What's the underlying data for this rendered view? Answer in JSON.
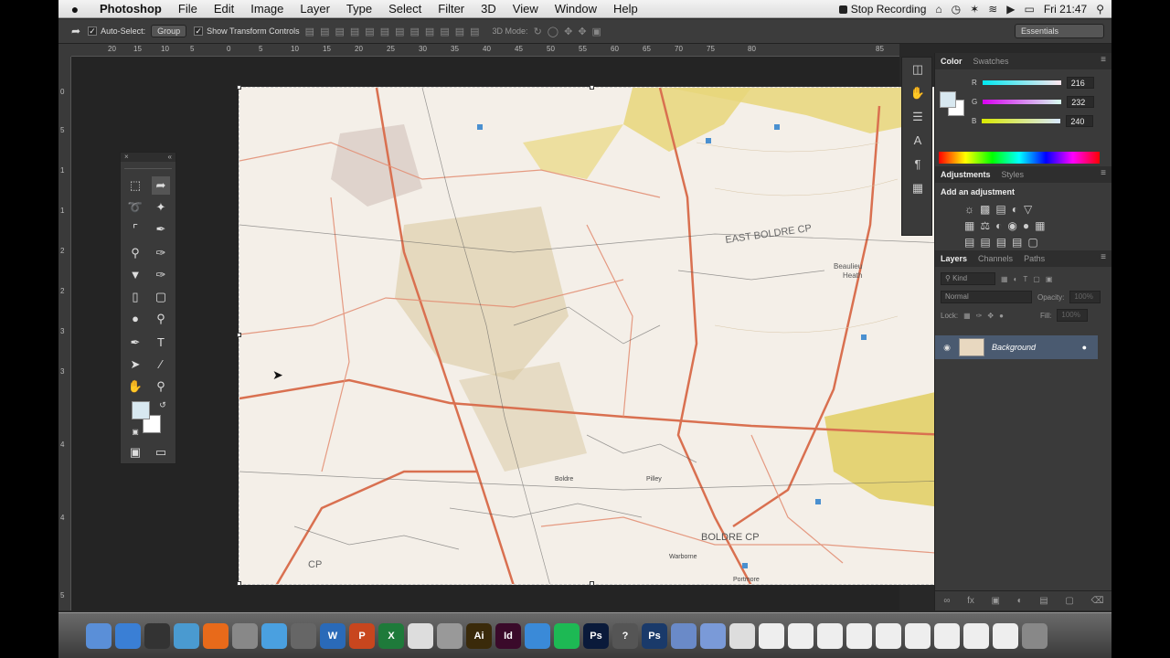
{
  "menubar": {
    "app": "Photoshop",
    "items": [
      "File",
      "Edit",
      "Image",
      "Layer",
      "Type",
      "Select",
      "Filter",
      "3D",
      "View",
      "Window",
      "Help"
    ],
    "stop_recording": "Stop Recording",
    "clock": "Fri 21:47"
  },
  "options": {
    "auto_select": "Auto-Select:",
    "group": "Group",
    "show_transform": "Show Transform Controls",
    "mode_3d": "3D Mode:",
    "workspace": "Essentials"
  },
  "ruler_h": [
    "20",
    "15",
    "10",
    "5",
    "0",
    "5",
    "10",
    "15",
    "20",
    "25",
    "30",
    "35",
    "40",
    "45",
    "50",
    "55",
    "60",
    "65",
    "70",
    "75",
    "80",
    "85"
  ],
  "ruler_v": [
    "0",
    "5",
    "1",
    "1",
    "2",
    "2",
    "3",
    "3",
    "4",
    "4",
    "5"
  ],
  "color_panel": {
    "tabs": [
      "Color",
      "Swatches"
    ],
    "r_label": "R",
    "r": "216",
    "g_label": "G",
    "g": "232",
    "b_label": "B",
    "b": "240",
    "fg_color": "#d8e8f0"
  },
  "adjustments": {
    "tabs": [
      "Adjustments",
      "Styles"
    ],
    "title": "Add an adjustment"
  },
  "layers_panel": {
    "tabs": [
      "Layers",
      "Channels",
      "Paths"
    ],
    "kind": "Kind",
    "blend": "Normal",
    "opacity_label": "Opacity:",
    "opacity": "100%",
    "lock_label": "Lock:",
    "fill_label": "Fill:",
    "fill": "100%",
    "layer_name": "Background"
  },
  "map_labels": {
    "east_boldre": "EAST BOLDRE CP",
    "beaulieu": "Beaulieu",
    "heath": "Heath",
    "boldre_cp": "BOLDRE CP",
    "warborne": "Warborne",
    "pilley": "Pilley",
    "portmore": "Portmore",
    "boldre": "Boldre",
    "cp": "CP"
  },
  "dock_apps": [
    {
      "label": "",
      "color": "#5a8fd8"
    },
    {
      "label": "",
      "color": "#3a7fd5"
    },
    {
      "label": "",
      "color": "#333"
    },
    {
      "label": "",
      "color": "#4a9ad0"
    },
    {
      "label": "",
      "color": "#e86a1a"
    },
    {
      "label": "",
      "color": "#888"
    },
    {
      "label": "",
      "color": "#4aa0e0"
    },
    {
      "label": "",
      "color": "#666"
    },
    {
      "label": "W",
      "color": "#2a6ab8"
    },
    {
      "label": "P",
      "color": "#c8461e"
    },
    {
      "label": "X",
      "color": "#1e7a3a"
    },
    {
      "label": "",
      "color": "#ddd"
    },
    {
      "label": "",
      "color": "#999"
    },
    {
      "label": "Ai",
      "color": "#3a2a0a"
    },
    {
      "label": "Id",
      "color": "#3a0a2a"
    },
    {
      "label": "",
      "color": "#3a8ad8"
    },
    {
      "label": "",
      "color": "#1db954"
    },
    {
      "label": "Ps",
      "color": "#0a1a3a"
    },
    {
      "label": "?",
      "color": "#555"
    },
    {
      "label": "Ps",
      "color": "#1a3a6a"
    },
    {
      "label": "",
      "color": "#6a8ac8"
    },
    {
      "label": "",
      "color": "#7a9ad8"
    },
    {
      "label": "",
      "color": "#ddd"
    },
    {
      "label": "",
      "color": "#eee"
    },
    {
      "label": "",
      "color": "#eee"
    },
    {
      "label": "",
      "color": "#eee"
    },
    {
      "label": "",
      "color": "#eee"
    },
    {
      "label": "",
      "color": "#eee"
    },
    {
      "label": "",
      "color": "#eee"
    },
    {
      "label": "",
      "color": "#eee"
    },
    {
      "label": "",
      "color": "#eee"
    },
    {
      "label": "",
      "color": "#eee"
    },
    {
      "label": "",
      "color": "#888"
    }
  ]
}
